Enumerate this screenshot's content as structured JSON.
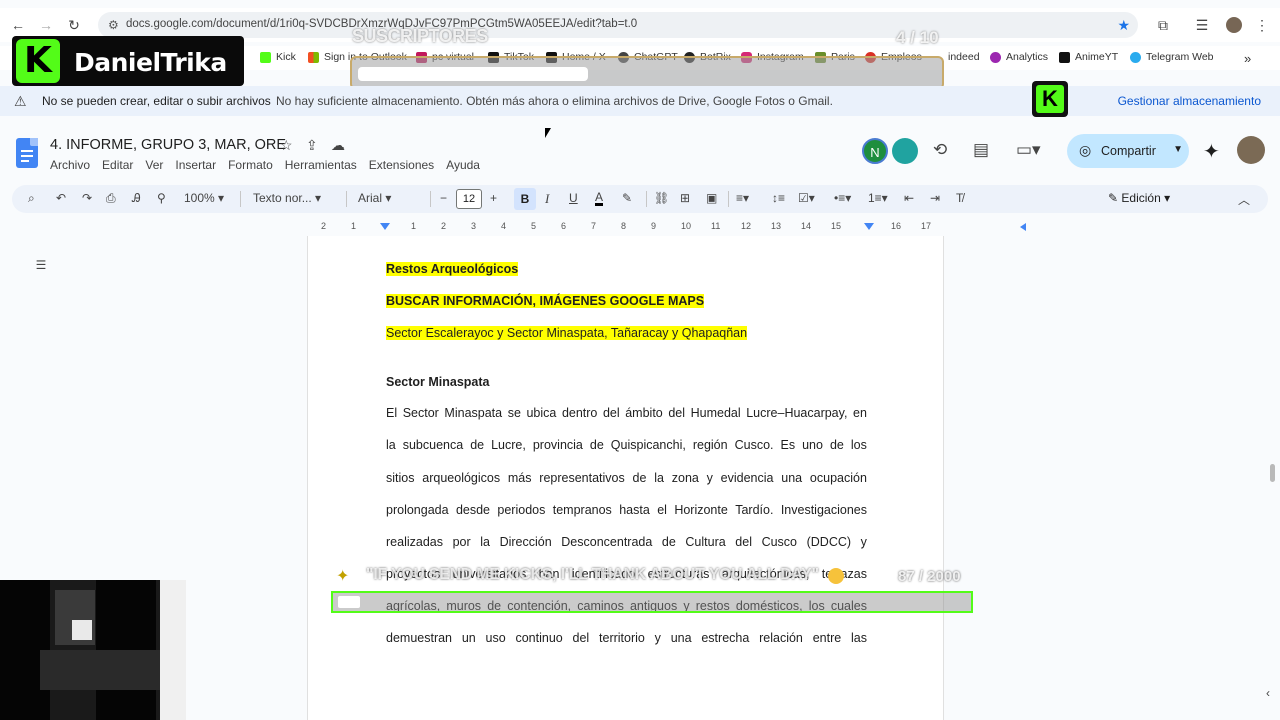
{
  "browser": {
    "url": "docs.google.com/document/d/1ri0q-SVDCBDrXmzrWqDJvFC97PmPCGtm5WA05EEJA/edit?tab=t.0",
    "bookmarks": [
      "Kick",
      "Sign in to Outlook",
      "pc virtual",
      "TikTok",
      "Home / X",
      "ChatGPT",
      "BotRix",
      "Instagram",
      "Paris",
      "Empleos",
      "indeed",
      "Analytics",
      "AnimeYT",
      "Telegram Web"
    ]
  },
  "overlay": {
    "brand": "DanielTrika",
    "brand_letter": "K",
    "subs_label": "SUSCRIPTORES",
    "subs_count": "4 / 10",
    "ticker": "\"IF YOU SEND ME KICKS, I'LL THANK ABOUT YOU ALL DAY\"",
    "ticker_count": "87 / 2000"
  },
  "banner": {
    "title": "No se pueden crear, editar o subir archivos",
    "message": "No hay suficiente almacenamiento. Obtén más ahora o elimina archivos de Drive, Google Fotos o Gmail.",
    "action": "Gestionar almacenamiento"
  },
  "docs": {
    "title": "4. INFORME, GRUPO 3, MAR, ORE",
    "menu": [
      "Archivo",
      "Editar",
      "Ver",
      "Insertar",
      "Formato",
      "Herramientas",
      "Extensiones",
      "Ayuda"
    ],
    "avatar_letter": "N",
    "share_label": "Compartir",
    "toolbar": {
      "zoom": "100%",
      "style": "Texto nor...",
      "font": "Arial",
      "font_size": "12",
      "bold": "B",
      "italic": "I",
      "underline": "U",
      "text_color": "A",
      "minus": "−",
      "plus": "+",
      "edit_mode": "Edición"
    },
    "ruler": [
      "2",
      "1",
      "1",
      "2",
      "3",
      "4",
      "5",
      "6",
      "7",
      "8",
      "9",
      "10",
      "11",
      "12",
      "13",
      "14",
      "15",
      "16",
      "17",
      "18"
    ]
  },
  "document": {
    "h1": "Restos Arqueológicos",
    "h2": "BUSCAR INFORMACIÓN, IMÁGENES GOOGLE MAPS",
    "h3": "Sector Escalerayoc y Sector Minaspata, Tañaracay y Qhapaqñan",
    "section_title": "Sector Minaspata",
    "paragraph": [
      "El Sector Minaspata se ubica dentro del ámbito del Humedal Lucre–Huacarpay, en",
      "la subcuenca de Lucre, provincia de Quispicanchi, región Cusco. Es uno de los",
      "sitios arqueológicos más representativos de la zona y evidencia una ocupación",
      "prolongada desde periodos tempranos hasta el Horizonte Tardío. Investigaciones",
      "realizadas por la Dirección Desconcentrada de Cultura del Cusco (DDCC) y",
      "proyectos universitarios han identificado estructuras arquitectónicas, terrazas",
      "agrícolas, muros de contención, caminos antiguos y restos domésticos, los cuales",
      "demuestran un uso continuo del territorio y una estrecha relación entre las"
    ]
  }
}
